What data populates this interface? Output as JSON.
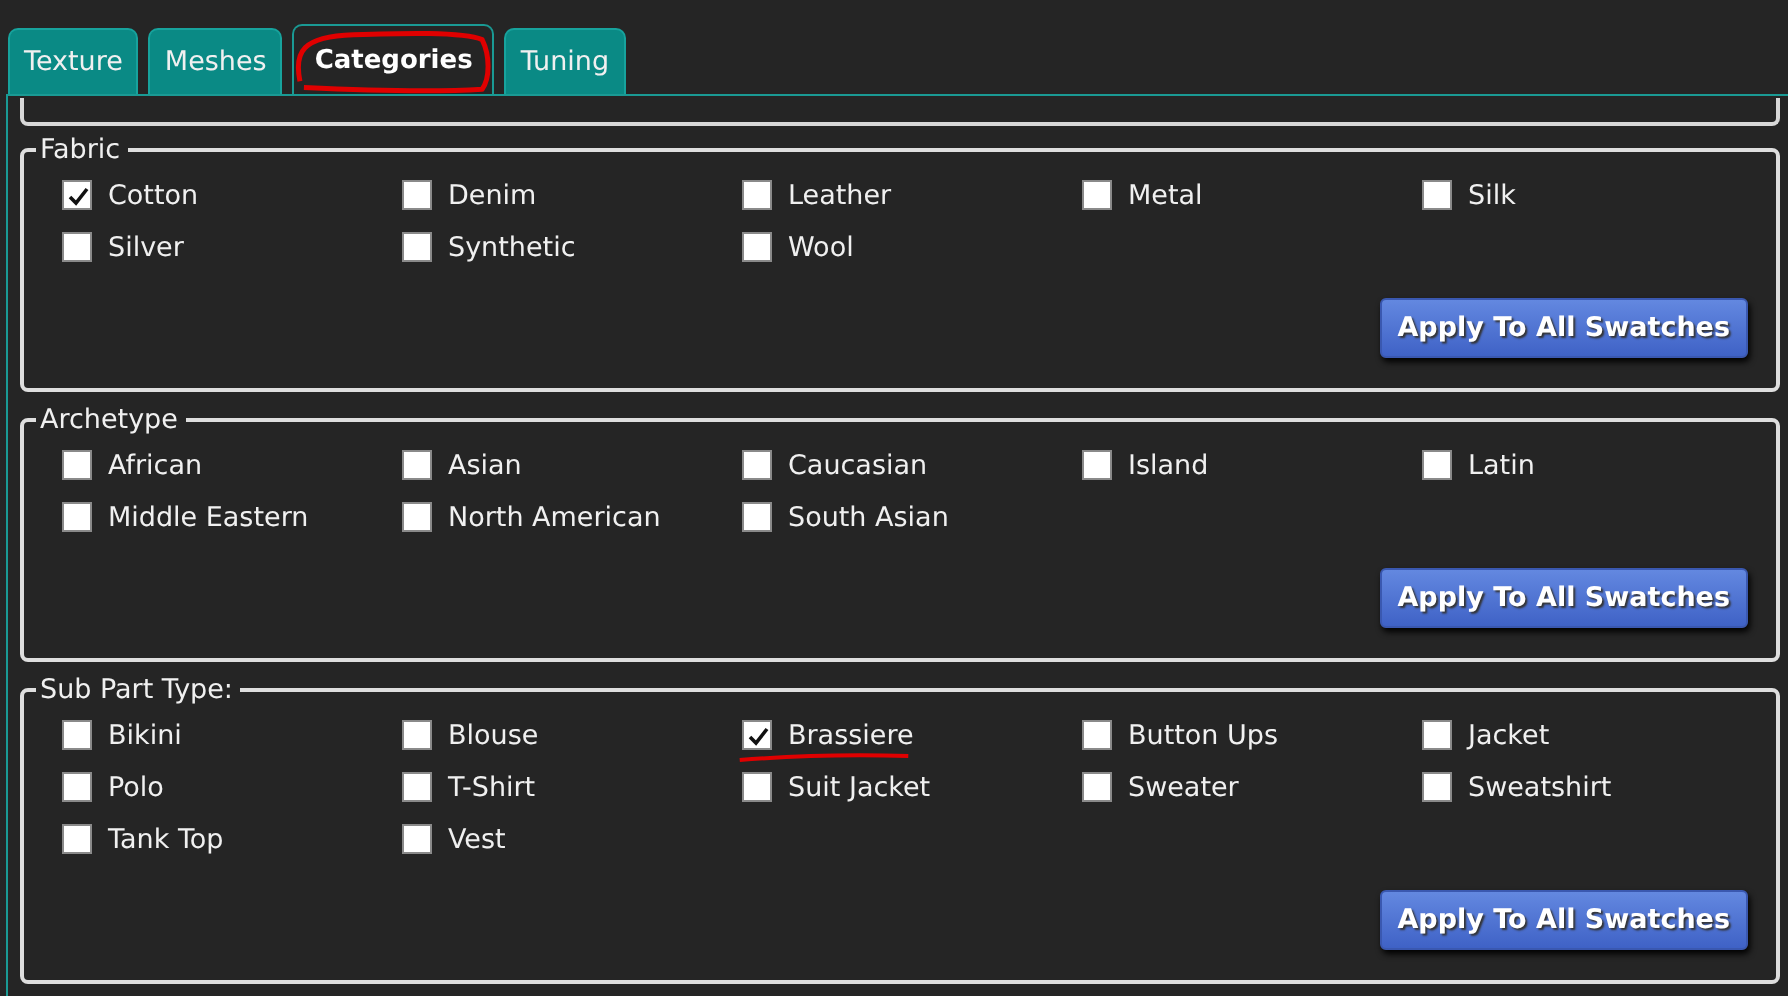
{
  "tabs": [
    {
      "label": "Texture",
      "selected": false,
      "circled": false
    },
    {
      "label": "Meshes",
      "selected": false,
      "circled": false
    },
    {
      "label": "Categories",
      "selected": true,
      "circled": true
    },
    {
      "label": "Tuning",
      "selected": false,
      "circled": false
    }
  ],
  "groups": [
    {
      "title": "Fabric",
      "options": [
        {
          "label": "Cotton",
          "checked": true,
          "underlined": false
        },
        {
          "label": "Denim",
          "checked": false,
          "underlined": false
        },
        {
          "label": "Leather",
          "checked": false,
          "underlined": false
        },
        {
          "label": "Metal",
          "checked": false,
          "underlined": false
        },
        {
          "label": "Silk",
          "checked": false,
          "underlined": false
        },
        {
          "label": "Silver",
          "checked": false,
          "underlined": false
        },
        {
          "label": "Synthetic",
          "checked": false,
          "underlined": false
        },
        {
          "label": "Wool",
          "checked": false,
          "underlined": false
        }
      ],
      "button": "Apply To All Swatches"
    },
    {
      "title": "Archetype",
      "options": [
        {
          "label": "African",
          "checked": false,
          "underlined": false
        },
        {
          "label": "Asian",
          "checked": false,
          "underlined": false
        },
        {
          "label": "Caucasian",
          "checked": false,
          "underlined": false
        },
        {
          "label": "Island",
          "checked": false,
          "underlined": false
        },
        {
          "label": "Latin",
          "checked": false,
          "underlined": false
        },
        {
          "label": "Middle Eastern",
          "checked": false,
          "underlined": false
        },
        {
          "label": "North American",
          "checked": false,
          "underlined": false
        },
        {
          "label": "South Asian",
          "checked": false,
          "underlined": false
        }
      ],
      "button": "Apply To All Swatches"
    },
    {
      "title": "Sub Part Type:",
      "options": [
        {
          "label": "Bikini",
          "checked": false,
          "underlined": false
        },
        {
          "label": "Blouse",
          "checked": false,
          "underlined": false
        },
        {
          "label": "Brassiere",
          "checked": true,
          "underlined": true
        },
        {
          "label": "Button Ups",
          "checked": false,
          "underlined": false
        },
        {
          "label": "Jacket",
          "checked": false,
          "underlined": false
        },
        {
          "label": "Polo",
          "checked": false,
          "underlined": false
        },
        {
          "label": "T-Shirt",
          "checked": false,
          "underlined": false
        },
        {
          "label": "Suit Jacket",
          "checked": false,
          "underlined": false
        },
        {
          "label": "Sweater",
          "checked": false,
          "underlined": false
        },
        {
          "label": "Sweatshirt",
          "checked": false,
          "underlined": false
        },
        {
          "label": "Tank Top",
          "checked": false,
          "underlined": false
        },
        {
          "label": "Vest",
          "checked": false,
          "underlined": false
        }
      ],
      "button": "Apply To All Swatches"
    }
  ]
}
